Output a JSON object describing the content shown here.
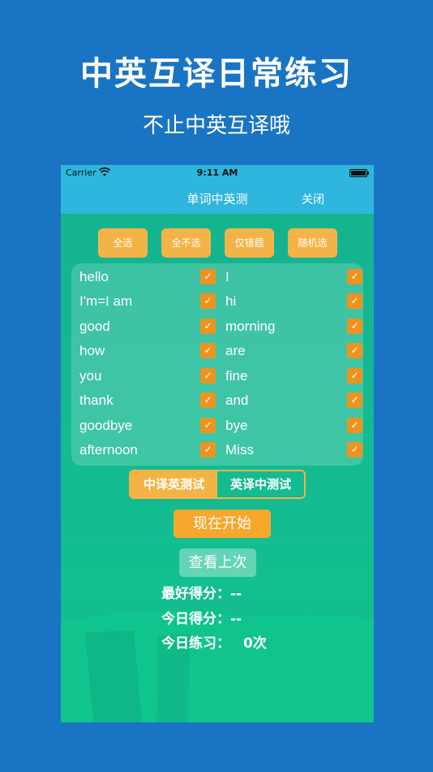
{
  "promo": {
    "title": "中英互译日常练习",
    "subtitle": "不止中英互译哦"
  },
  "statusbar": {
    "carrier": "Carrier",
    "time": "9:11 AM"
  },
  "navbar": {
    "title": "单词中英测",
    "close_label": "关闭"
  },
  "filters": [
    {
      "label": "全选"
    },
    {
      "label": "全不选"
    },
    {
      "label": "仅错题"
    },
    {
      "label": "随机选"
    }
  ],
  "words": [
    {
      "word": "hello",
      "checked": true
    },
    {
      "word": "I",
      "checked": true
    },
    {
      "word": "I'm=I am",
      "checked": true
    },
    {
      "word": "hi",
      "checked": true
    },
    {
      "word": "good",
      "checked": true
    },
    {
      "word": "morning",
      "checked": true
    },
    {
      "word": "how",
      "checked": true
    },
    {
      "word": "are",
      "checked": true
    },
    {
      "word": "you",
      "checked": true
    },
    {
      "word": "fine",
      "checked": true
    },
    {
      "word": "thank",
      "checked": true
    },
    {
      "word": "and",
      "checked": true
    },
    {
      "word": "goodbye",
      "checked": true
    },
    {
      "word": "bye",
      "checked": true
    },
    {
      "word": "afternoon",
      "checked": true
    },
    {
      "word": "Miss",
      "checked": true
    }
  ],
  "checkmark": "✓",
  "mode": {
    "options": [
      "中译英测试",
      "英译中测试"
    ],
    "selected": "中译英测试"
  },
  "actions": {
    "start_label": "现在开始",
    "view_last_label": "查看上次"
  },
  "stats": {
    "best_label": "最好得分：",
    "best_value": "--",
    "today_label": "今日得分：",
    "today_value": "--",
    "practice_label": "今日练习：",
    "practice_value": "0次"
  },
  "colors": {
    "background": "#1a74c4",
    "navbar": "#2fb6dc",
    "accent": "#f4b346",
    "checkbox": "#ef9320"
  }
}
